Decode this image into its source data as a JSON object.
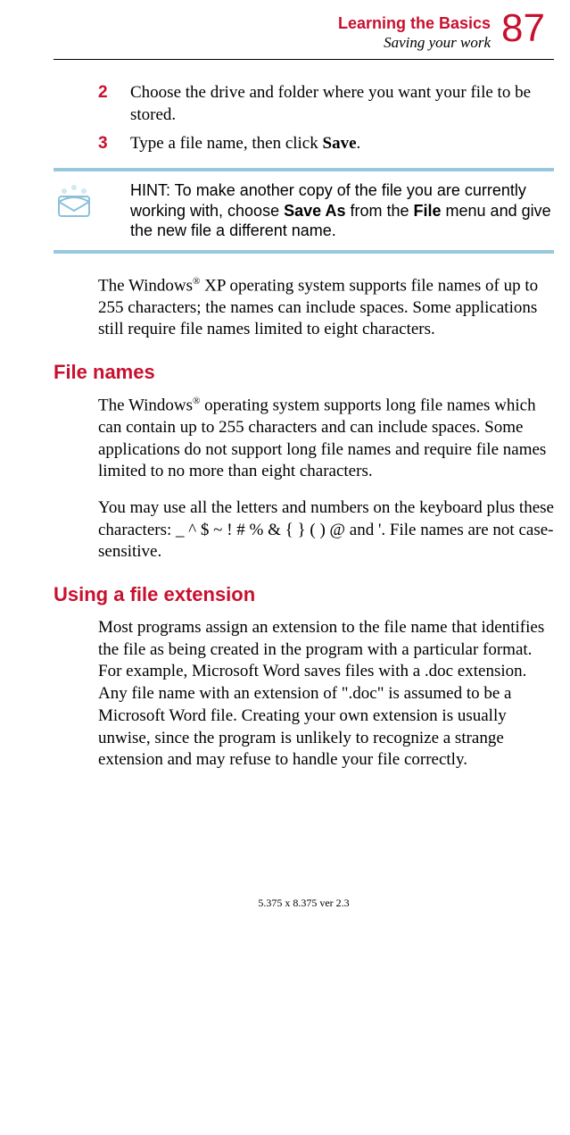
{
  "header": {
    "chapter": "Learning the Basics",
    "section": "Saving your work",
    "page": "87"
  },
  "steps": [
    {
      "num": "2",
      "text": "Choose the drive and folder where you want your file to be stored."
    },
    {
      "num": "3",
      "prefix": "Type a file name, then click ",
      "bold": "Save",
      "suffix": "."
    }
  ],
  "hint": {
    "prefix": "HINT: To make another copy of the file you are currently working with, choose ",
    "bold1": "Save As",
    "mid": " from the ",
    "bold2": "File",
    "suffix": " menu and give the new file a different name."
  },
  "para1_a": "The Windows",
  "para1_sup": "®",
  "para1_b": " XP operating system supports file names of up to 255 characters; the names can include spaces. Some applications still require file names limited to eight characters.",
  "h2a": "File names",
  "para2_a": "The Windows",
  "para2_sup": "®",
  "para2_b": " operating system supports long file names which can contain up to 255 characters and can include spaces. Some applications do not support long file names and require file names limited to no more than eight characters.",
  "para3": "You may use all the letters and numbers on the keyboard plus these characters: _ ^ $ ~ ! # % & { } ( ) @ and '. File names are not case-sensitive.",
  "h2b": "Using a file extension",
  "para4": "Most programs assign an extension to the file name that identifies the file as being created in the program with a particular format. For example, Microsoft Word saves files with a .doc extension. Any file name with an extension of \".doc\" is assumed to be a Microsoft Word file. Creating your own extension is usually unwise, since the program is unlikely to recognize a strange extension and may refuse to handle your file correctly.",
  "footer": "5.375 x 8.375 ver 2.3"
}
